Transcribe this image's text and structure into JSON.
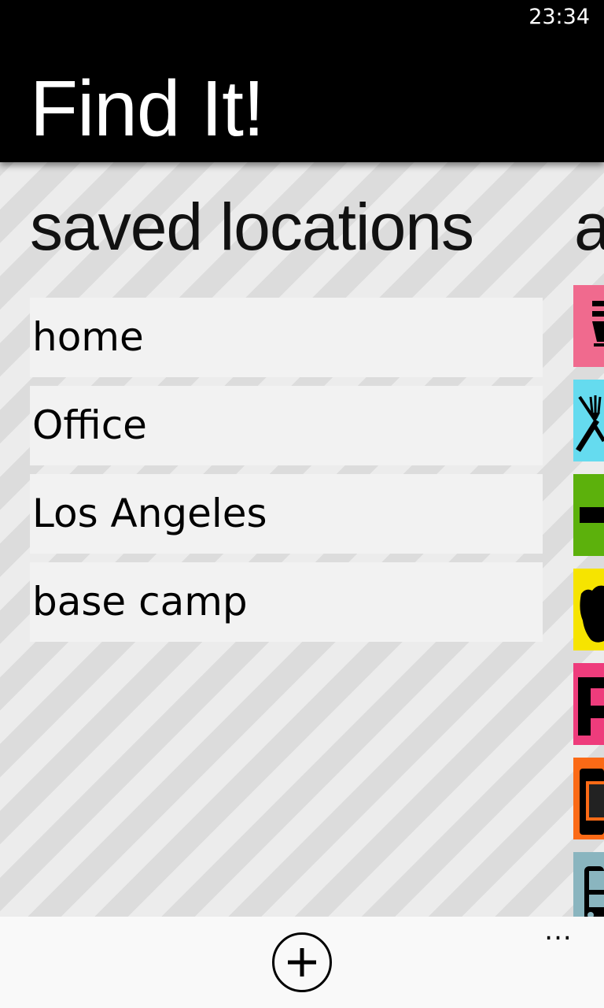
{
  "status_bar": {
    "time": "23:34"
  },
  "header": {
    "title": "Find It!"
  },
  "pivot": {
    "current": "saved locations",
    "next_peek": "a"
  },
  "saved_locations": [
    {
      "label": "home"
    },
    {
      "label": "Office"
    },
    {
      "label": "Los Angeles"
    },
    {
      "label": "base camp"
    }
  ],
  "category_tiles": [
    {
      "icon": "fuel-icon",
      "color": "#f06a8e"
    },
    {
      "icon": "restaurant-icon",
      "color": "#65dbef"
    },
    {
      "icon": "medical-icon",
      "color": "#5cb10c"
    },
    {
      "icon": "police-icon",
      "color": "#f6e400"
    },
    {
      "icon": "parking-icon",
      "color": "#ee3c7c"
    },
    {
      "icon": "atm-icon",
      "color": "#fb6a16"
    },
    {
      "icon": "bus-icon",
      "color": "#8ab5bf"
    }
  ],
  "app_bar": {
    "add_icon": "add-icon",
    "more_label": "..."
  }
}
